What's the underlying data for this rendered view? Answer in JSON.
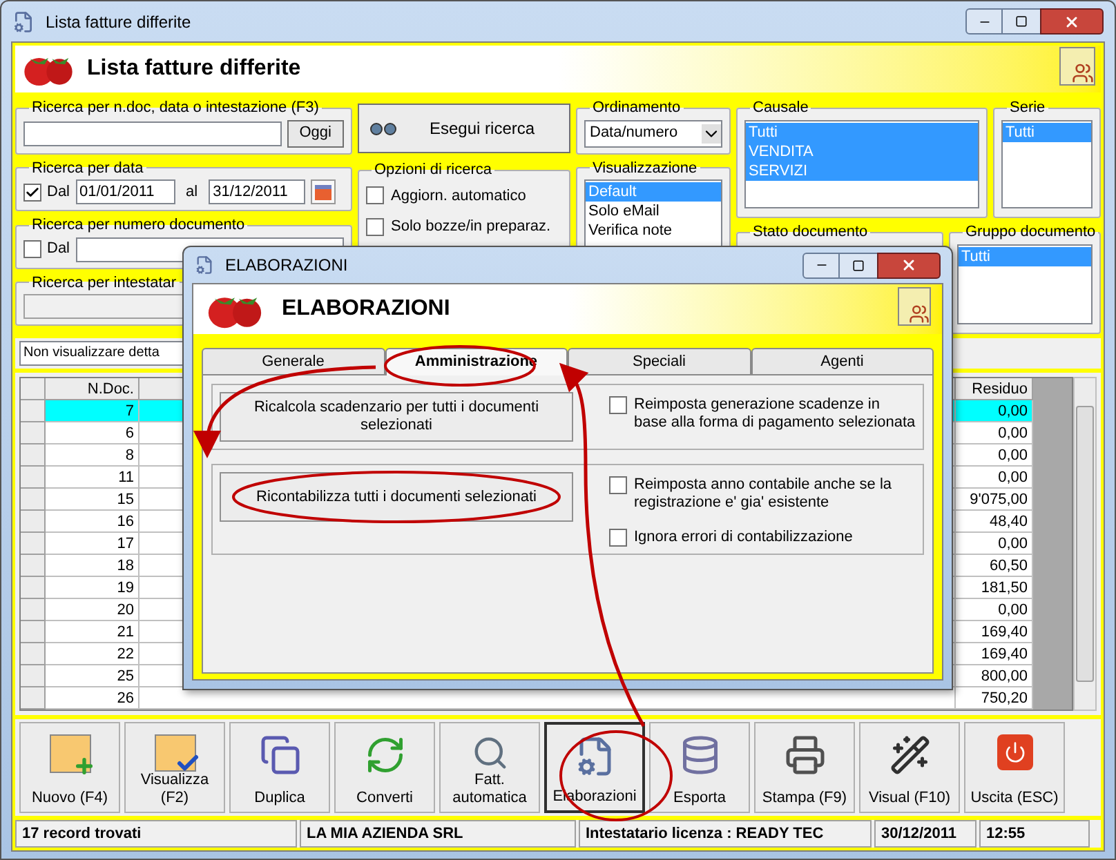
{
  "window": {
    "title": "Lista fatture differite"
  },
  "header": {
    "title": "Lista fatture differite"
  },
  "text_search": {
    "legend": "Ricerca per n.doc, data o intestazione (F3)",
    "button": "Oggi"
  },
  "search_button": "Esegui ricerca",
  "date_search": {
    "legend": "Ricerca per data",
    "checkbox_label": "Dal",
    "checked": true,
    "from": "01/01/2011",
    "to_label": "al",
    "to": "31/12/2011"
  },
  "number_search": {
    "legend": "Ricerca per numero documento",
    "checkbox_label": "Dal",
    "checked": false
  },
  "holder_search": {
    "legend": "Ricerca per intestatar"
  },
  "search_options": {
    "legend": "Opzioni di ricerca",
    "options": [
      {
        "label": "Aggiorn. automatico",
        "checked": false
      },
      {
        "label": "Solo bozze/in preparaz.",
        "checked": false
      }
    ]
  },
  "sort": {
    "legend": "Ordinamento",
    "value": "Data/numero"
  },
  "view": {
    "legend": "Visualizzazione",
    "items": [
      {
        "label": "Default",
        "selected": true
      },
      {
        "label": "Solo eMail",
        "selected": false
      },
      {
        "label": "Verifica note",
        "selected": false
      }
    ]
  },
  "causale": {
    "legend": "Causale",
    "items": [
      {
        "label": "Tutti",
        "selected": true
      },
      {
        "label": "VENDITA",
        "selected": true
      },
      {
        "label": "SERVIZI",
        "selected": true
      }
    ]
  },
  "serie": {
    "legend": "Serie",
    "items": [
      {
        "label": "Tutti",
        "selected": true
      }
    ]
  },
  "document_state": {
    "legend": "Stato documento"
  },
  "document_group": {
    "legend": "Gruppo documento",
    "items": [
      {
        "label": "Tutti",
        "selected": true
      }
    ]
  },
  "detail_dropdown": {
    "value": "Non visualizzare detta"
  },
  "table": {
    "columns": [
      "N.Doc.",
      "Residuo"
    ],
    "rows": [
      {
        "n_doc": "7",
        "residuo": "0,00",
        "selected": true
      },
      {
        "n_doc": "6",
        "residuo": "0,00",
        "selected": false
      },
      {
        "n_doc": "8",
        "residuo": "0,00",
        "selected": false
      },
      {
        "n_doc": "11",
        "residuo": "0,00",
        "selected": false
      },
      {
        "n_doc": "15",
        "residuo": "9'075,00",
        "selected": false
      },
      {
        "n_doc": "16",
        "residuo": "48,40",
        "selected": false
      },
      {
        "n_doc": "17",
        "residuo": "0,00",
        "selected": false
      },
      {
        "n_doc": "18",
        "residuo": "60,50",
        "selected": false
      },
      {
        "n_doc": "19",
        "residuo": "181,50",
        "selected": false
      },
      {
        "n_doc": "20",
        "residuo": "0,00",
        "selected": false
      },
      {
        "n_doc": "21",
        "residuo": "169,40",
        "selected": false
      },
      {
        "n_doc": "22",
        "residuo": "169,40",
        "selected": false
      },
      {
        "n_doc": "25",
        "residuo": "800,00",
        "selected": false
      },
      {
        "n_doc": "26",
        "residuo": "750,20",
        "selected": false
      }
    ]
  },
  "toolbar": [
    {
      "label": "Nuovo (F4)",
      "selected": false
    },
    {
      "label": "Visualizza (F2)",
      "selected": false
    },
    {
      "label": "Duplica",
      "selected": false
    },
    {
      "label": "Converti",
      "selected": false
    },
    {
      "label": "Fatt. automatica",
      "selected": false
    },
    {
      "label": "Elaborazioni",
      "selected": true
    },
    {
      "label": "Esporta",
      "selected": false
    },
    {
      "label": "Stampa (F9)",
      "selected": false
    },
    {
      "label": "Visual (F10)",
      "selected": false
    },
    {
      "label": "Uscita (ESC)",
      "selected": false
    }
  ],
  "status_bar": [
    "17 record trovati",
    "LA MIA AZIENDA SRL",
    "Intestatario licenza : READY TEC",
    "30/12/2011",
    "12:55"
  ],
  "dialog": {
    "title": "ELABORAZIONI",
    "header": "ELABORAZIONI",
    "tabs": [
      {
        "label": "Generale",
        "selected": false
      },
      {
        "label": "Amministrazione",
        "selected": true
      },
      {
        "label": "Speciali",
        "selected": false
      },
      {
        "label": "Agenti",
        "selected": false
      }
    ],
    "actions": [
      {
        "button": "Ricalcola scadenzario per tutti i documenti selezionati",
        "options": [
          {
            "label": "Reimposta generazione scadenze in base alla forma di pagamento selezionata",
            "checked": false
          }
        ]
      },
      {
        "button": "Ricontabilizza tutti i documenti selezionati",
        "options": [
          {
            "label": "Reimposta anno contabile anche se la registrazione e' gia' esistente",
            "checked": false
          },
          {
            "label": "Ignora errori di contabilizzazione",
            "checked": false
          }
        ]
      }
    ]
  }
}
